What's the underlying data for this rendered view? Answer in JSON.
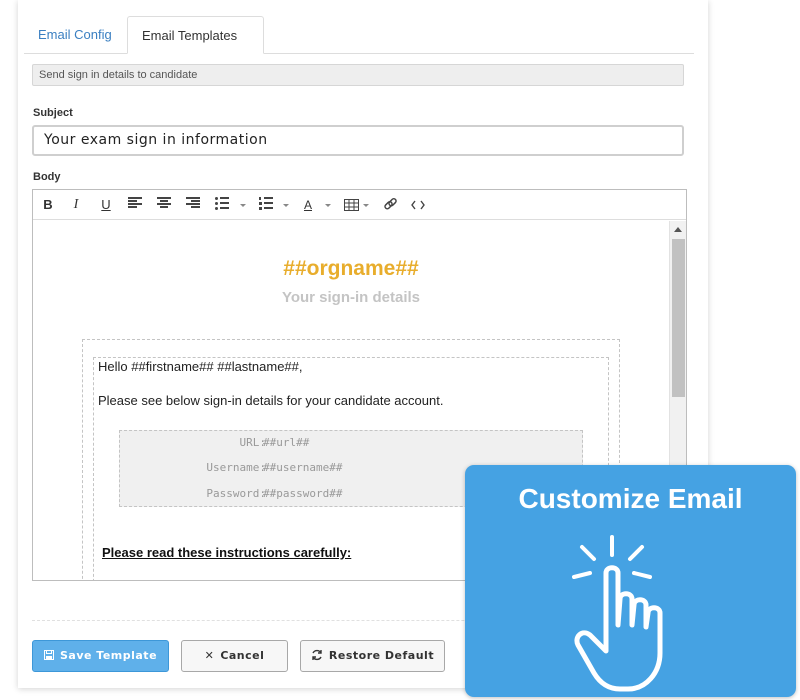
{
  "tabs": {
    "email_config": "Email Config",
    "email_templates": "Email Templates"
  },
  "template_description": "Send sign in details to candidate",
  "subject": {
    "label": "Subject",
    "value": "Your exam sign in information"
  },
  "body": {
    "label": "Body",
    "toolbar": {
      "bold": "B",
      "italic": "I",
      "underline": "U",
      "font_color": "A",
      "icons": [
        "bold-icon",
        "italic-icon",
        "underline-icon",
        "align-left-icon",
        "align-center-icon",
        "align-right-icon",
        "bullet-list-icon",
        "numbered-list-icon",
        "font-color-icon",
        "table-icon",
        "link-icon",
        "code-view-icon"
      ]
    },
    "content": {
      "org_name": "##orgname##",
      "subtitle": "Your sign-in details",
      "greeting": "Hello ##firstname## ##lastname##,",
      "intro": "Please see below sign-in details for your candidate account.",
      "credentials": [
        {
          "label": "URL:",
          "value": "##url##"
        },
        {
          "label": "Username:",
          "value": "##username##"
        },
        {
          "label": "Password:",
          "value": "##password##"
        }
      ],
      "instructions_heading": "Please read these instructions carefully:"
    }
  },
  "buttons": {
    "save": "Save Template",
    "cancel": "Cancel",
    "restore": "Restore Default"
  },
  "promo": {
    "title": "Customize Email",
    "icon": "pointing-hand-icon"
  },
  "colors": {
    "link": "#3a7fc1",
    "org_name": "#e8ad2c",
    "save_button": "#5fb0ea",
    "promo_background": "#45a2e3"
  }
}
